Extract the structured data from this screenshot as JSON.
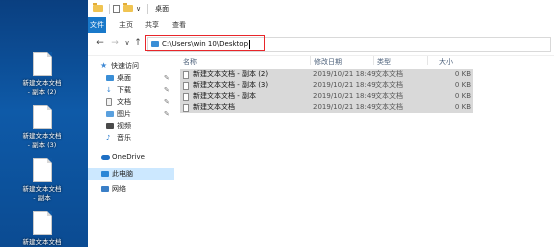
{
  "window": {
    "title": "桌面",
    "qa_caret": "∨"
  },
  "ribbon": {
    "tabs": [
      "文件",
      "主页",
      "共享",
      "查看"
    ]
  },
  "nav": {
    "back": "←",
    "forward": "→",
    "history": "∨",
    "up": "↑",
    "address": "C:\\Users\\win 10\\Desktop"
  },
  "sidebar": {
    "items": [
      {
        "label": "快速访问",
        "icon": "star-icon"
      },
      {
        "label": "桌面",
        "icon": "desktop-icon",
        "pin": "📌"
      },
      {
        "label": "下载",
        "icon": "download-icon",
        "pin": "📌"
      },
      {
        "label": "文档",
        "icon": "document-icon",
        "pin": "📌"
      },
      {
        "label": "图片",
        "icon": "picture-icon",
        "pin": "📌"
      },
      {
        "label": "视频",
        "icon": "video-icon"
      },
      {
        "label": "音乐",
        "icon": "music-icon"
      },
      {
        "label": "OneDrive",
        "icon": "cloud-icon"
      },
      {
        "label": "此电脑",
        "icon": "computer-icon"
      },
      {
        "label": "网络",
        "icon": "network-icon"
      }
    ]
  },
  "columns": {
    "name": "名称",
    "date": "修改日期",
    "type": "类型",
    "size": "大小"
  },
  "files": [
    {
      "name": "新建文本文档 - 副本 (2)",
      "date": "2019/10/21 18:49",
      "type": "文本文档",
      "size": "0 KB"
    },
    {
      "name": "新建文本文档 - 副本 (3)",
      "date": "2019/10/21 18:49",
      "type": "文本文档",
      "size": "0 KB"
    },
    {
      "name": "新建文本文档 - 副本",
      "date": "2019/10/21 18:49",
      "type": "文本文档",
      "size": "0 KB"
    },
    {
      "name": "新建文本文档",
      "date": "2019/10/21 18:49",
      "type": "文本文档",
      "size": "0 KB"
    }
  ],
  "desktop_icons": [
    {
      "line1": "新建文本文档",
      "line2": "- 副本 (2)"
    },
    {
      "line1": "新建文本文档",
      "line2": "- 副本 (3)"
    },
    {
      "line1": "新建文本文档",
      "line2": "- 副本"
    },
    {
      "line1": "新建文本文档",
      "line2": ""
    }
  ],
  "colors": {
    "accent": "#1979ca",
    "highlight_box": "#e8262a",
    "selected_row": "#d9d9d9"
  }
}
